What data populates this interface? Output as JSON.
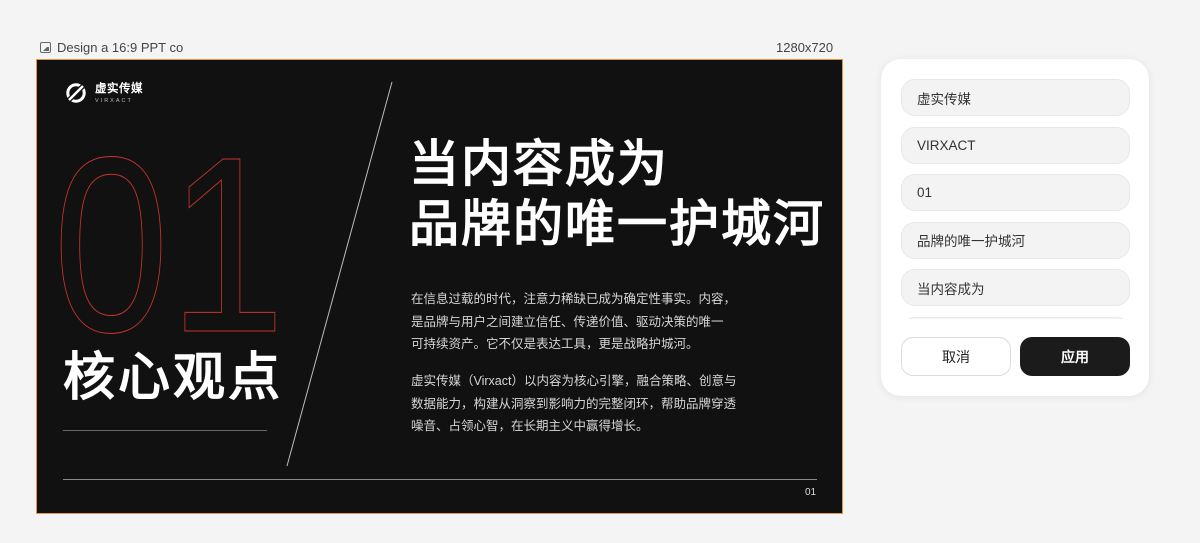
{
  "caption": {
    "title": "Design a 16:9 PPT co",
    "icon": "image-icon",
    "dims": "1280x720"
  },
  "slide": {
    "logo": {
      "icon": "virxact-logo-icon",
      "cn": "虚实传媒",
      "en": "VIRXACT"
    },
    "big_number": "01",
    "key_title": "核心观点",
    "headline_line1": "当内容成为",
    "headline_line2": "品牌的唯一护城河",
    "para1_line1": "在信息过载的时代，注意力稀缺已成为确定性事实。内容，",
    "para1_line2": "是品牌与用户之间建立信任、传递价值、驱动决策的唯一",
    "para1_line3": "可持续资产。它不仅是表达工具，更是战略护城河。",
    "para2_line1": "虚实传媒（Virxact）以内容为核心引擎，融合策略、创意与",
    "para2_line2": "数据能力，构建从洞察到影响力的完整闭环，帮助品牌穿透",
    "para2_line3": "噪音、占领心智，在长期主义中赢得增长。",
    "page_number": "01",
    "colors": {
      "background": "#111111",
      "accent": "#c8342c",
      "frame": "#e3953f"
    }
  },
  "panel": {
    "fields": [
      {
        "value": "虚实传媒"
      },
      {
        "value": "VIRXACT"
      },
      {
        "value": "01"
      },
      {
        "value": "品牌的唯一护城河"
      },
      {
        "value": "当内容成为"
      },
      {
        "value": ""
      }
    ],
    "cancel_label": "取消",
    "apply_label": "应用"
  }
}
